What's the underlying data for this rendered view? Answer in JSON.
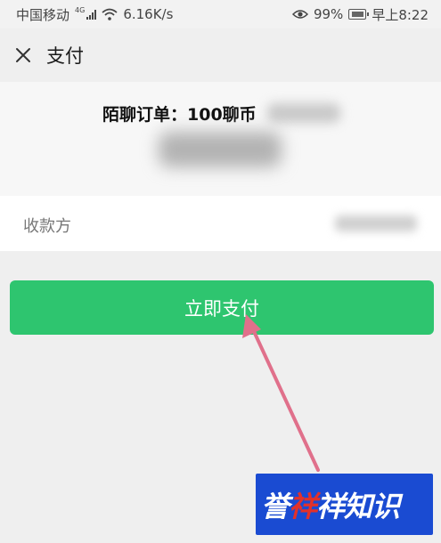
{
  "status_bar": {
    "carrier": "中国移动",
    "network": "4G",
    "speed": "6.16K/s",
    "battery": "99%",
    "time": "早上8:22"
  },
  "nav": {
    "title": "支付",
    "close_icon": "close-icon"
  },
  "order": {
    "title": "陌聊订单：100聊币"
  },
  "payee": {
    "label": "收款方"
  },
  "actions": {
    "pay_label": "立即支付"
  },
  "watermark": {
    "text": "誉祥祥知识"
  },
  "colors": {
    "pay_button": "#2ec56f",
    "arrow": "#e0708b",
    "watermark_bg": "#1a4bd2"
  }
}
